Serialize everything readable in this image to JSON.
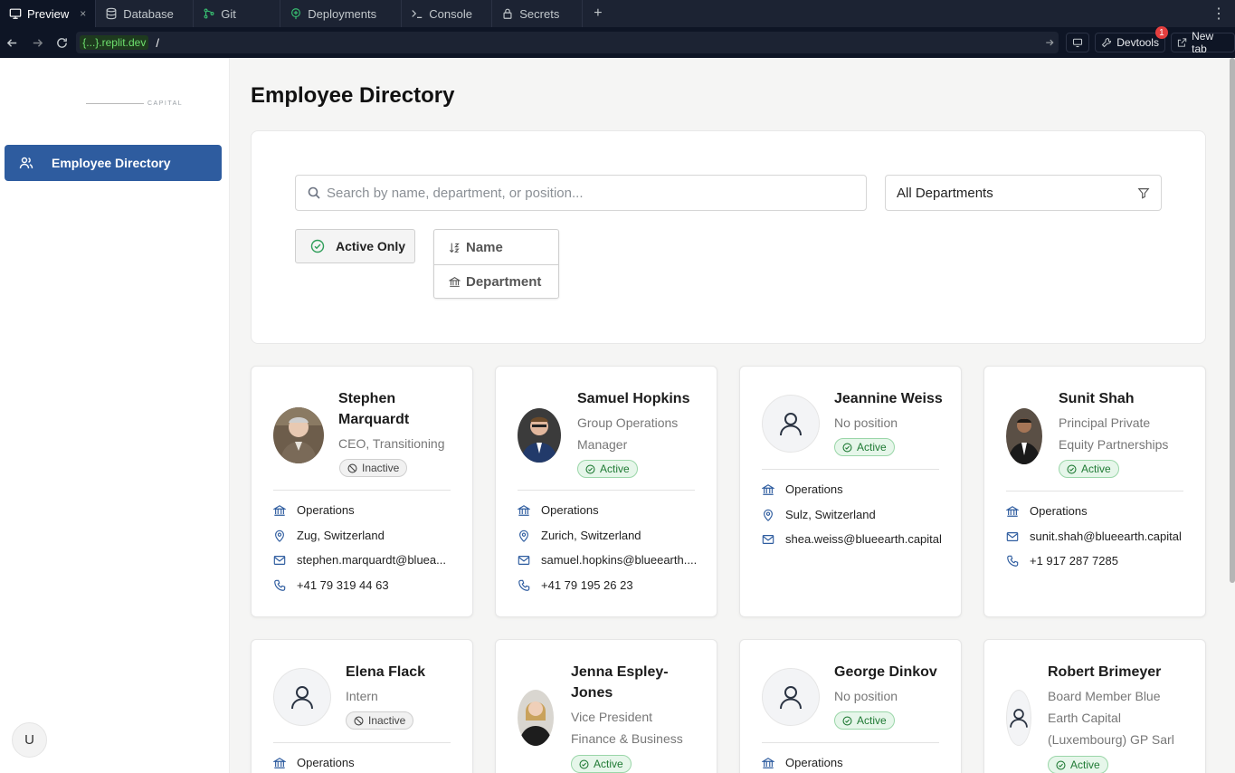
{
  "ide": {
    "tabs": [
      {
        "label": "Preview",
        "icon": "monitor-icon"
      },
      {
        "label": "Database",
        "icon": "database-icon"
      },
      {
        "label": "Git",
        "icon": "git-icon"
      },
      {
        "label": "Deployments",
        "icon": "deploy-icon"
      },
      {
        "label": "Console",
        "icon": "terminal-icon"
      },
      {
        "label": "Secrets",
        "icon": "lock-icon"
      }
    ],
    "tab_close": "×",
    "add": "+",
    "more": "⋮"
  },
  "urlbar": {
    "host_prefix": "{...}",
    "host_suffix": ".replit.dev",
    "path": "/",
    "devtools_label": "Devtools",
    "devtools_badge": "1",
    "new_tab_label": "New tab"
  },
  "sidebar": {
    "logo_text": "CAPITAL",
    "items": [
      {
        "label": "Employee Directory"
      }
    ],
    "user_initial": "U"
  },
  "page": {
    "title": "Employee Directory",
    "search_placeholder": "Search by name, department, or position...",
    "department_filter": "All Departments",
    "active_only_label": "Active Only",
    "sort_options": [
      "Name",
      "Department"
    ]
  },
  "employees": [
    {
      "name_l1": "Stephen",
      "name_l2": "Marquardt",
      "position_l1": "CEO, Transitioning",
      "status": "Inactive",
      "department": "Operations",
      "location": "Zug, Switzerland",
      "email": "stephen.marquardt@bluea...",
      "phone": "+41 79 319 44 63"
    },
    {
      "name_l1": "Samuel Hopkins",
      "position_l1": "Group Operations",
      "position_l2": "Manager",
      "status": "Active",
      "department": "Operations",
      "location": "Zurich, Switzerland",
      "email": "samuel.hopkins@blueearth....",
      "phone": "+41 79 195 26 23"
    },
    {
      "name_l1": "Jeannine Weiss",
      "position_l1": "No position",
      "status": "Active",
      "department": "Operations",
      "location": "Sulz, Switzerland",
      "email": "shea.weiss@blueearth.capital"
    },
    {
      "name_l1": "Sunit Shah",
      "position_l1": "Principal Private",
      "position_l2": "Equity Partnerships",
      "status": "Active",
      "department": "Operations",
      "email": "sunit.shah@blueearth.capital",
      "phone": "+1 917 287 7285"
    },
    {
      "name_l1": "Elena Flack",
      "position_l1": "Intern",
      "status": "Inactive",
      "department": "Operations"
    },
    {
      "name_l1": "Jenna Espley-",
      "name_l2": "Jones",
      "position_l1": "Vice President",
      "position_l2": "Finance & Business",
      "status": "Active"
    },
    {
      "name_l1": "George Dinkov",
      "position_l1": "No position",
      "status": "Active",
      "department": "Operations"
    },
    {
      "name_l1": "Robert Brimeyer",
      "position_l1": "Board Member Blue",
      "position_l2": "Earth Capital",
      "position_l3": "(Luxembourg) GP Sarl",
      "status": "Active"
    }
  ]
}
